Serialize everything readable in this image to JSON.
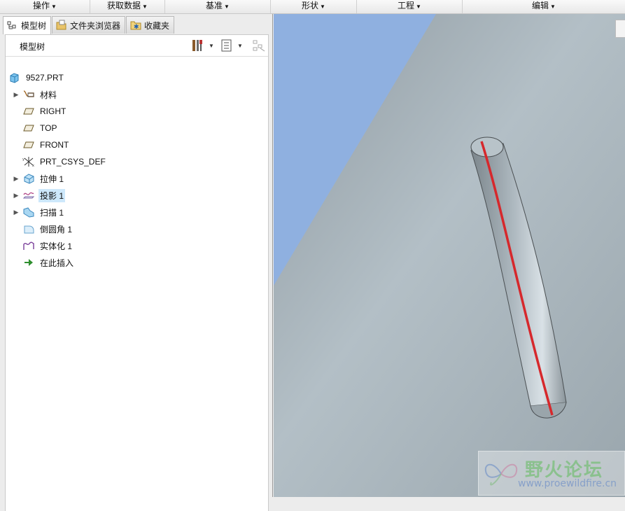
{
  "menubar": {
    "items": [
      {
        "label": "操作"
      },
      {
        "label": "获取数据"
      },
      {
        "label": "基准"
      },
      {
        "label": "形状"
      },
      {
        "label": "工程"
      },
      {
        "label": "编辑"
      }
    ]
  },
  "tabs": [
    {
      "label": "模型树",
      "icon": "model-tree-icon",
      "active": true
    },
    {
      "label": "文件夹浏览器",
      "icon": "folder-browser-icon",
      "active": false
    },
    {
      "label": "收藏夹",
      "icon": "favorites-icon",
      "active": false
    }
  ],
  "tree": {
    "header_title": "模型树",
    "root": "9527.PRT",
    "items": [
      {
        "label": "材料",
        "icon": "material-icon",
        "expandable": true
      },
      {
        "label": "RIGHT",
        "icon": "datum-plane-icon",
        "expandable": false
      },
      {
        "label": "TOP",
        "icon": "datum-plane-icon",
        "expandable": false
      },
      {
        "label": "FRONT",
        "icon": "datum-plane-icon",
        "expandable": false
      },
      {
        "label": "PRT_CSYS_DEF",
        "icon": "csys-icon",
        "expandable": false
      },
      {
        "label": "拉伸 1",
        "icon": "extrude-icon",
        "expandable": true
      },
      {
        "label": "投影 1",
        "icon": "projection-icon",
        "expandable": true,
        "selected": true
      },
      {
        "label": "扫描 1",
        "icon": "sweep-icon",
        "expandable": true
      },
      {
        "label": "倒圆角 1",
        "icon": "round-icon",
        "expandable": false
      },
      {
        "label": "实体化 1",
        "icon": "solidify-icon",
        "expandable": false
      },
      {
        "label": "在此插入",
        "icon": "insert-here-arrow-icon",
        "expandable": false
      }
    ]
  },
  "viewport": {
    "watermark_title": "野火论坛",
    "watermark_url": "www.proewildfire.cn"
  },
  "colors": {
    "background_sky": "#8fb0e0",
    "surface": "#a9b4bb",
    "curve": "#d6282c",
    "selection": "#cde8fb"
  }
}
